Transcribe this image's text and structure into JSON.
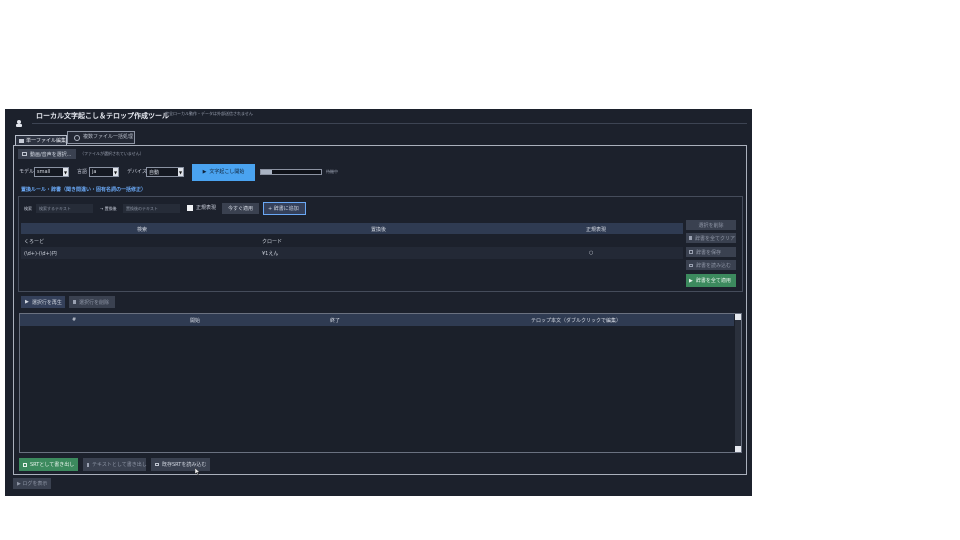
{
  "app": {
    "title": "ローカル文字起こし＆テロップ作成ツール",
    "subtitle": "完全ローカル動作・データは外部送信されません"
  },
  "tabs": [
    {
      "label": "単一ファイル編集",
      "active": true
    },
    {
      "label": "複数ファイル一括処理",
      "active": false
    }
  ],
  "file": {
    "select_button": "動画/音声を選択...",
    "status": "（ファイルが選択されていません）"
  },
  "options": {
    "model_label": "モデル",
    "model_value": "small",
    "language_label": "言語",
    "language_value": "ja",
    "device_label": "デバイス",
    "device_value": "自動",
    "start_button": "文字起こし開始",
    "progress": 0.18,
    "status": "待機中"
  },
  "dictionary": {
    "section_title": "置換ルール・辞書（聞き間違い・固有名詞の一括修正）",
    "search_label": "検索",
    "search_placeholder": "検索するテキスト",
    "replace_label": "→ 置換後",
    "replace_placeholder": "置換後のテキスト",
    "regex_label": "正規表現",
    "apply_now_button": "今すぐ適用",
    "add_button": "+ 辞書に追加",
    "columns": [
      "検索",
      "置換後",
      "正規表現"
    ],
    "rows": [
      {
        "search": "くろーど",
        "replace": "クロード",
        "regex": ""
      },
      {
        "search": "(\\d+)-(\\d+)円",
        "replace": "¥1えん",
        "regex": "○"
      }
    ],
    "side_buttons": {
      "delete_selected": "選択を削除",
      "clear_all": "辞書を全てクリア",
      "save": "辞書を保存",
      "load": "辞書を読み込む",
      "apply_all": "辞書を全て適用"
    }
  },
  "segments": {
    "play_button": "選択行を再生",
    "delete_button": "選択行を削除",
    "columns": [
      "#",
      "開始",
      "終了",
      "テロップ本文（ダブルクリックで編集）"
    ]
  },
  "bottom": {
    "srt_button": "SRTとして書き出し",
    "text_button": "テキストとして書き出し",
    "load_srt_button": "既存SRTを読み込む",
    "log_button": "▶ ログを表示"
  },
  "colors": {
    "accent_blue": "#4aa3f0",
    "accent_green": "#3c8a5e",
    "section_title": "#6aa8f5",
    "panel": "#1c212c",
    "header_row": "#2f3b52"
  }
}
